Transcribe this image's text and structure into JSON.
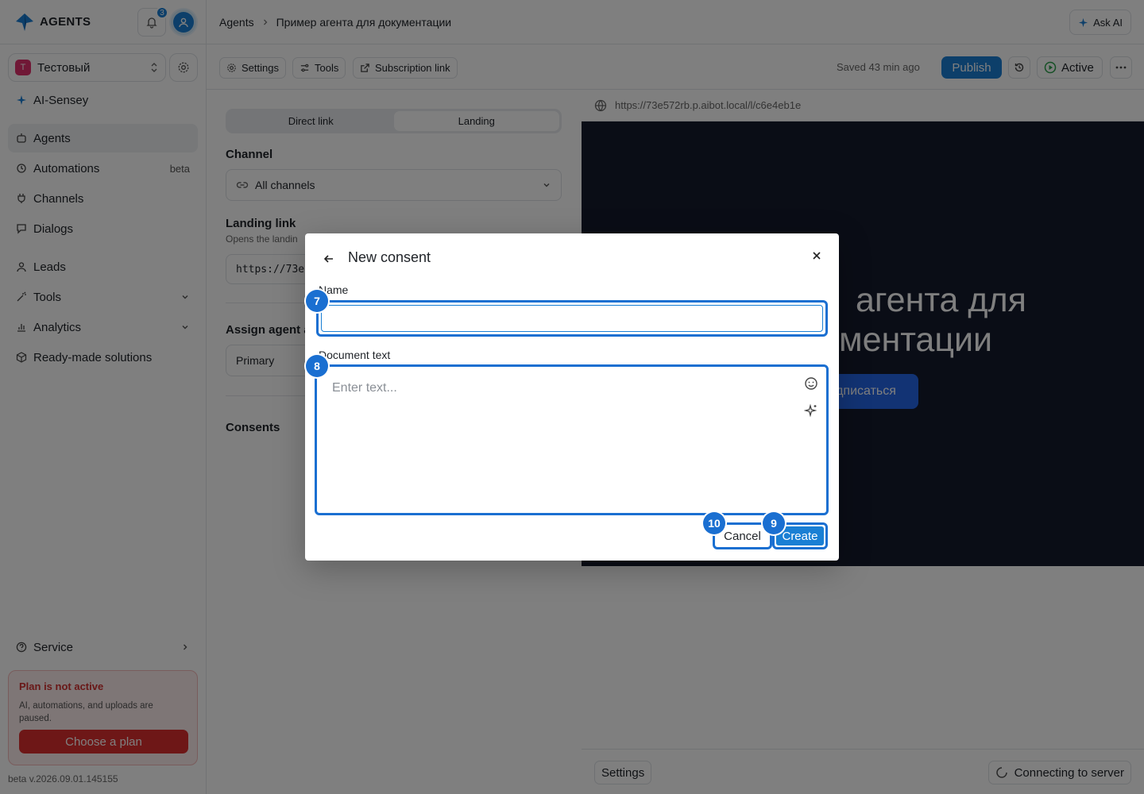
{
  "sidebar": {
    "brand": "AGENTS",
    "notifications_count": "3",
    "workspace": {
      "initial": "Т",
      "name": "Тестовый"
    },
    "ai_item": "AI-Sensey",
    "items": [
      {
        "label": "Agents",
        "active": true
      },
      {
        "label": "Automations",
        "badge": "beta"
      },
      {
        "label": "Channels"
      },
      {
        "label": "Dialogs"
      },
      {
        "label": "Leads"
      },
      {
        "label": "Tools"
      },
      {
        "label": "Analytics"
      },
      {
        "label": "Ready-made solutions"
      }
    ],
    "service": "Service",
    "plan": {
      "title": "Plan is not active",
      "description": "AI, automations, and uploads are paused.",
      "button": "Choose a plan"
    },
    "version": "beta v.2026.09.01.145155"
  },
  "topbar": {
    "breadcrumb": [
      "Agents",
      "Пример агента для документации"
    ],
    "ask_ai": "Ask AI"
  },
  "toolbar": {
    "settings": "Settings",
    "tools": "Tools",
    "subscription_link": "Subscription link",
    "saved": "Saved 43 min ago",
    "publish": "Publish",
    "status": "Active"
  },
  "content": {
    "tabs": [
      "Direct link",
      "Landing"
    ],
    "selected_tab": "Landing",
    "channel_label": "Channel",
    "channel_value": "All channels",
    "landing_link_label": "Landing link",
    "landing_link_sub": "Opens the landin",
    "landing_link_value": "https://73e",
    "assign_label": "Assign agent a",
    "assign_value": "Primary",
    "consents_label": "Consents"
  },
  "preview": {
    "url": "https://73e572rb.p.aibot.local/l/c6e4eb1e",
    "title_line1": "агента для",
    "title_line2": "ментации",
    "button": "дписаться",
    "settings": "Settings",
    "connection": "Connecting to server"
  },
  "modal": {
    "title": "New consent",
    "name_label": "Name",
    "name_value": "",
    "doc_label": "Document text",
    "doc_placeholder": "Enter text...",
    "cancel": "Cancel",
    "create": "Create"
  },
  "markers": [
    "7",
    "8",
    "9",
    "10"
  ],
  "colors": {
    "accent": "#1a7fd4",
    "danger": "#dc2f2f",
    "preview_bg": "#141b2d",
    "marker": "#1a6fd1"
  }
}
